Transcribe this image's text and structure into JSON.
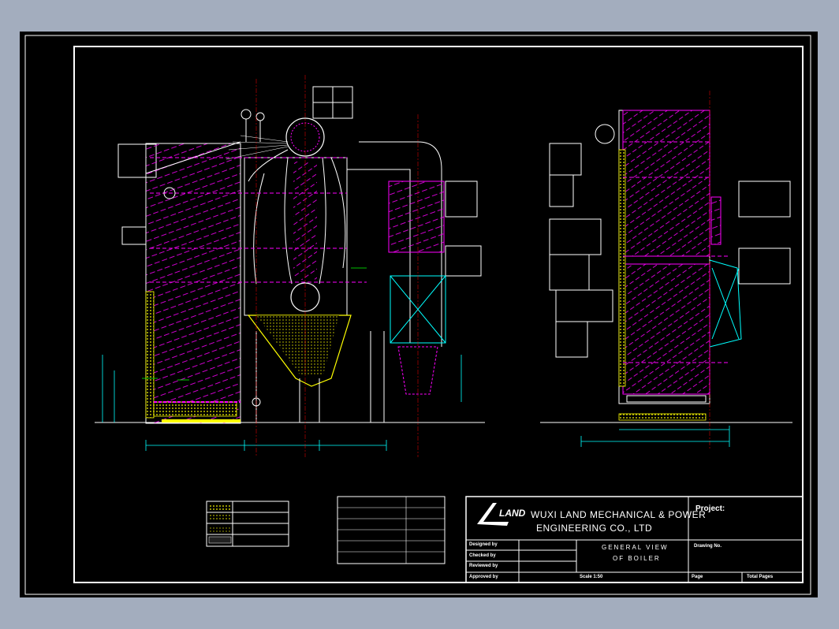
{
  "colors": {
    "background": "#a3adbe",
    "sheet": "#000000",
    "frame": "#ffffff",
    "boiler_tubes": "#ff00ff",
    "dimensions": "#00ffff",
    "refractory": "#ffff00",
    "structure": "#ffffff",
    "annotation": "#00ff00"
  },
  "title_block": {
    "company_line1": "WUXI LAND MECHANICAL & POWER",
    "company_line2": "ENGINEERING CO., LTD",
    "logo_text": "LAND",
    "project_label": "Project:",
    "drawing_title_line1": "GENERAL    VIEW",
    "drawing_title_line2": "OF    BOILER",
    "drawing_no_label": "Drawing No.",
    "designed_by": "Designed by",
    "checked_by": "Checked by",
    "reviewed_by": "Reviewed by",
    "approved_by": "Approved by",
    "scale_label": "Scale 1:50",
    "page_label": "Page",
    "total_pages_label": "Total Pages"
  }
}
